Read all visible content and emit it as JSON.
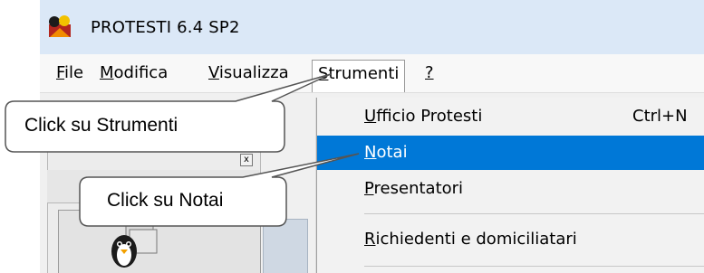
{
  "window": {
    "title": "PROTESTI 6.4 SP2"
  },
  "menubar": {
    "items": [
      {
        "mnemonic": "F",
        "rest": "ile"
      },
      {
        "mnemonic": "M",
        "rest": "odifica"
      },
      {
        "mnemonic": "V",
        "rest": "isualizza"
      },
      {
        "mnemonic": "S",
        "rest": "trumenti"
      },
      {
        "mnemonic": "?",
        "rest": ""
      }
    ]
  },
  "dropdown": {
    "items": [
      {
        "mnemonic": "U",
        "rest": "fficio Protesti",
        "shortcut": "Ctrl+N"
      },
      {
        "mnemonic": "N",
        "rest": "otai",
        "shortcut": ""
      },
      {
        "mnemonic": "P",
        "rest": "resentatori",
        "shortcut": ""
      },
      {
        "mnemonic": "R",
        "rest": "ichiedenti e domiciliatari",
        "shortcut": ""
      }
    ],
    "highlight_color": "#0078d7"
  },
  "callouts": {
    "strumenti": "Click su Strumenti",
    "notai": "Click su Notai"
  },
  "icons": [
    "app-icon",
    "printer-icon",
    "penguin-icon",
    "close-icon"
  ]
}
